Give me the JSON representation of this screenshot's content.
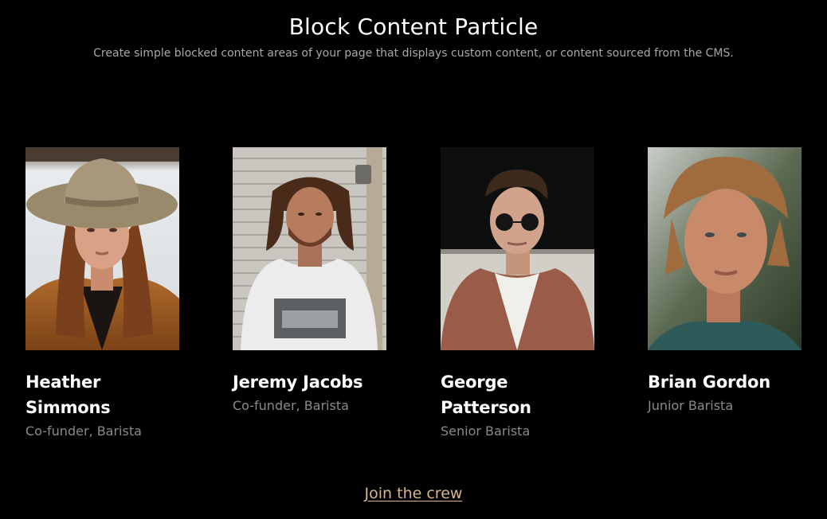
{
  "header": {
    "title": "Block Content Particle",
    "subtitle": "Create simple blocked content areas of your page that displays custom content, or content sourced from the CMS."
  },
  "team": [
    {
      "name_line1": "Heather",
      "name_line2": "Simmons",
      "role": "Co-funder, Barista"
    },
    {
      "name_line1": "Jeremy Jacobs",
      "name_line2": "",
      "role": "Co-funder, Barista"
    },
    {
      "name_line1": "George Patterson",
      "name_line2": "",
      "role": "Senior Barista"
    },
    {
      "name_line1": "Brian Gordon",
      "name_line2": "",
      "role": "Junior Barista"
    }
  ],
  "cta": {
    "label": "Join the crew"
  },
  "colors": {
    "background": "#000000",
    "title": "#ffffff",
    "subtitle": "#a7a7a7",
    "role": "#8a8a8a",
    "cta": "#d9b78a"
  }
}
